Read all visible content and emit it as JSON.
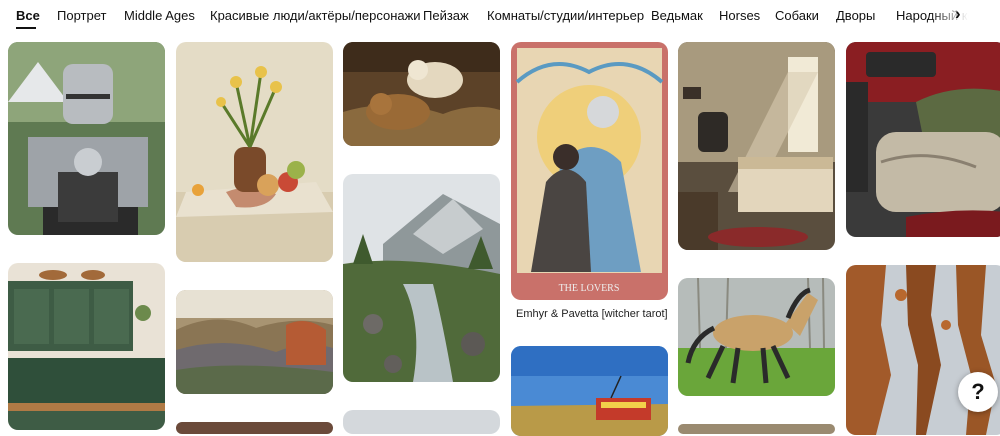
{
  "tabs": [
    {
      "label": "Все",
      "active": true
    },
    {
      "label": "Портрет"
    },
    {
      "label": "Middle Ages"
    },
    {
      "label": "Красивые люди/актёры/персонажи"
    },
    {
      "label": "Пейзаж"
    },
    {
      "label": "Комнаты/студии/интерьер"
    },
    {
      "label": "Ведьмак"
    },
    {
      "label": "Horses"
    },
    {
      "label": "Собаки"
    },
    {
      "label": "Дворы"
    },
    {
      "label": "Народный кос"
    }
  ],
  "icons": {
    "next": "chevron-right-icon",
    "help": "help-icon"
  },
  "arrow_glyph": "›",
  "help_glyph": "?",
  "pins": [
    {
      "subject": "knight in armor"
    },
    {
      "subject": "still life with flowers and fruit"
    },
    {
      "subject": "lion cubs"
    },
    {
      "subject": "mountain river"
    },
    {
      "subject": "The Lovers tarot card",
      "card_text": "THE LOVERS",
      "caption": "Emhyr & Pavetta [witcher tarot]"
    },
    {
      "subject": "cozy bedroom interior"
    },
    {
      "subject": "person in car"
    },
    {
      "subject": "green kitchen"
    },
    {
      "subject": "autumn grass field"
    },
    {
      "subject": "horse running"
    },
    {
      "subject": "tram in field"
    },
    {
      "subject": "rust texture"
    }
  ]
}
